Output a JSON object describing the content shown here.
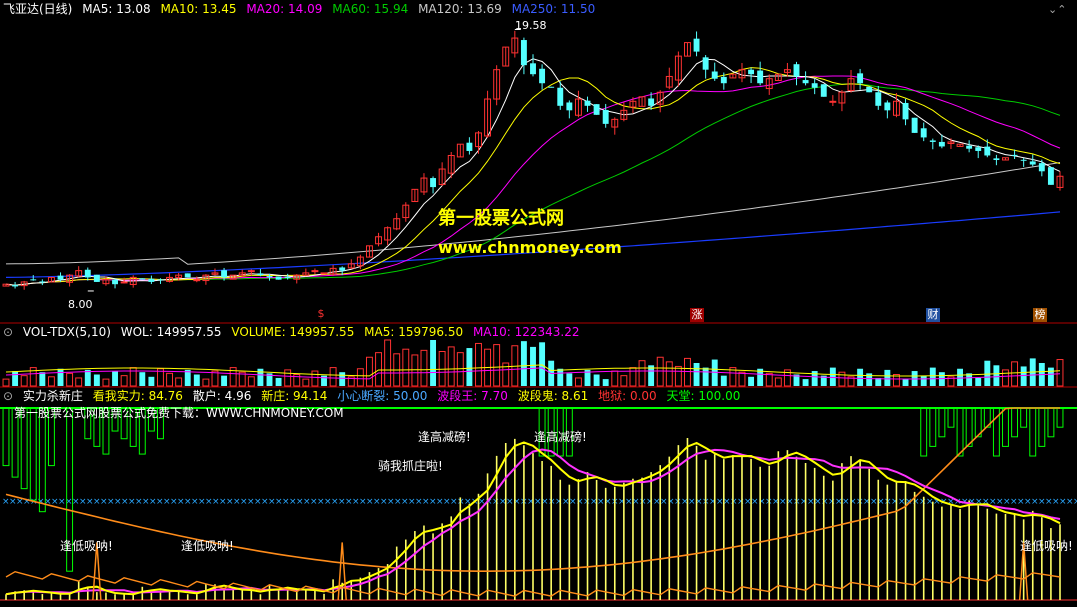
{
  "colors": {
    "bg": "#000000",
    "up": "#ff3232",
    "down": "#54ffff",
    "ma5": "#ffffff",
    "ma10": "#ffff00",
    "ma20": "#ff00ff",
    "ma60": "#00cc00",
    "ma120": "#c8c8c8",
    "ma250": "#1a3cff",
    "border": "#b00000",
    "green": "#00ff00"
  },
  "main": {
    "title": "飞亚达(日线)",
    "ma5": "MA5: 13.08",
    "ma10": "MA10: 13.45",
    "ma20": "MA20: 14.09",
    "ma60": "MA60: 15.94",
    "ma120": "MA120: 13.69",
    "ma250": "MA250: 11.50",
    "high_label": "19.58",
    "low_label": "8.00",
    "watermark1": "第一股票公式网",
    "watermark2": "www.chnmoney.com",
    "markers": [
      "$",
      "涨",
      "财",
      "榜"
    ]
  },
  "vol": {
    "title": "VOL-TDX(5,10)",
    "wol": "WOL: 149957.55",
    "volume": "VOLUME: 149957.55",
    "ma5": "MA5: 159796.50",
    "ma10": "MA10: 122343.22"
  },
  "ind": {
    "title": "实力杀新庄",
    "k1": "看我实力: 84.76",
    "k2": "散户: 4.96",
    "k3": "新庄: 94.14",
    "k4": "小心断裂: 50.00",
    "k5": "波段王: 7.70",
    "k6": "波段鬼: 8.61",
    "k7": "地狱: 0.00",
    "k8": "天堂: 100.00",
    "subtitle": "第一股票公式网股票公式免费下载：WWW.CHNMONEY.COM",
    "tags": [
      "逢低吸呐!",
      "逢低吸呐!",
      "逢低吸呐!",
      "逢高减磅!",
      "逢高减磅!",
      "骑我抓庄啦!"
    ]
  },
  "chart_data": {
    "type": "candlestick",
    "price": {
      "low_mark": 8.0,
      "high_mark": 19.58,
      "closes": [
        8.3,
        8.2,
        8.4,
        8.5,
        8.4,
        8.6,
        8.5,
        8.7,
        8.9,
        8.6,
        8.4,
        8.5,
        8.3,
        8.4,
        8.6,
        8.5,
        8.4,
        8.5,
        8.6,
        8.7,
        8.6,
        8.5,
        8.7,
        8.8,
        8.6,
        8.7,
        8.8,
        8.9,
        8.7,
        8.6,
        8.5,
        8.6,
        8.7,
        8.8,
        8.9,
        8.8,
        9.0,
        8.9,
        9.2,
        9.5,
        10.0,
        10.4,
        10.8,
        11.2,
        11.8,
        12.5,
        13.0,
        12.6,
        13.4,
        14.0,
        14.5,
        14.2,
        15.0,
        16.5,
        17.8,
        18.8,
        19.2,
        18.0,
        17.6,
        17.2,
        17.0,
        16.2,
        16.0,
        16.5,
        16.2,
        15.8,
        15.4,
        15.6,
        16.0,
        16.4,
        16.6,
        16.2,
        16.8,
        17.5,
        18.4,
        19.0,
        18.6,
        17.8,
        17.4,
        17.2,
        17.6,
        17.8,
        17.6,
        17.2,
        17.4,
        17.6,
        17.8,
        17.5,
        17.2,
        17.0,
        16.6,
        16.4,
        16.8,
        17.4,
        17.2,
        16.8,
        16.2,
        16.0,
        16.4,
        15.6,
        15.0,
        14.8,
        14.6,
        14.4,
        14.6,
        14.5,
        14.3,
        14.2,
        14.0,
        13.8,
        13.9,
        14.0,
        13.8,
        13.6,
        13.3,
        12.7,
        13.08
      ]
    }
  }
}
